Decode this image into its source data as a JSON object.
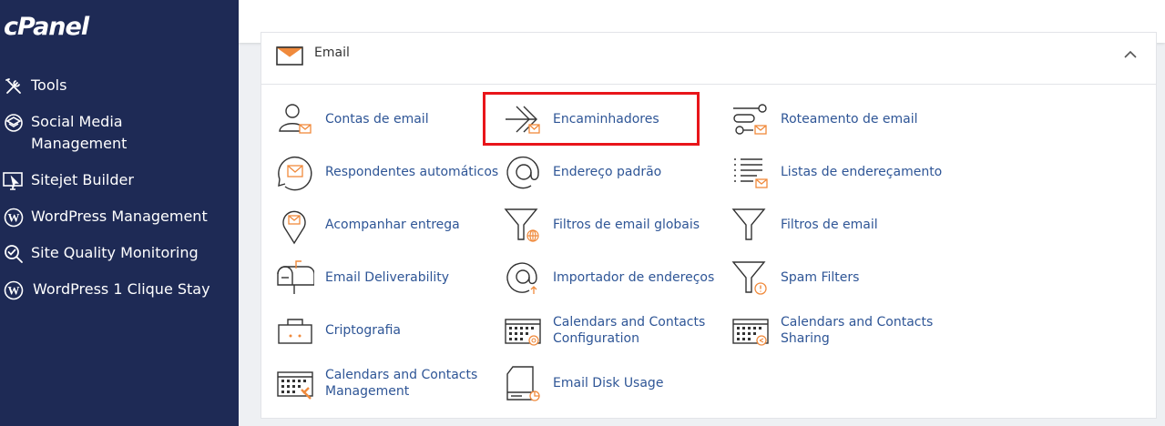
{
  "brand": {
    "logo": "cPanel"
  },
  "sidebar": {
    "items": [
      {
        "label": "Tools",
        "icon": "tools-icon"
      },
      {
        "label": "Social Media Management",
        "icon": "social-media-icon"
      },
      {
        "label": "Sitejet Builder",
        "icon": "sitejet-icon"
      },
      {
        "label": "WordPress Management",
        "icon": "wordpress-icon"
      },
      {
        "label": "Site Quality Monitoring",
        "icon": "site-quality-icon"
      },
      {
        "label": "WordPress 1 Clique Stay",
        "icon": "wordpress-icon"
      }
    ]
  },
  "section": {
    "title": "Email",
    "icon": "envelope-icon",
    "expanded": true
  },
  "tools": [
    {
      "label": "Contas de email",
      "icon": "email-accounts-icon"
    },
    {
      "label": "Encaminhadores",
      "icon": "forwarders-icon"
    },
    {
      "label": "Roteamento de email",
      "icon": "email-routing-icon"
    },
    {
      "label": "Respondentes automáticos",
      "icon": "autoresponders-icon"
    },
    {
      "label": "Endereço padrão",
      "icon": "default-address-icon"
    },
    {
      "label": "Listas de endereçamento",
      "icon": "mailing-lists-icon"
    },
    {
      "label": "Acompanhar entrega",
      "icon": "track-delivery-icon"
    },
    {
      "label": "Filtros de email globais",
      "icon": "global-filters-icon"
    },
    {
      "label": "Filtros de email",
      "icon": "email-filters-icon"
    },
    {
      "label": "Email Deliverability",
      "icon": "mailbox-icon"
    },
    {
      "label": "Importador de endereços",
      "icon": "address-importer-icon"
    },
    {
      "label": "Spam Filters",
      "icon": "spam-filters-icon"
    },
    {
      "label": "Criptografia",
      "icon": "encryption-icon"
    },
    {
      "label": "Calendars and Contacts Configuration",
      "icon": "calendar-config-icon"
    },
    {
      "label": "Calendars and Contacts Sharing",
      "icon": "calendar-sharing-icon"
    },
    {
      "label": "Calendars and Contacts Management",
      "icon": "calendar-management-icon"
    },
    {
      "label": "Email Disk Usage",
      "icon": "disk-usage-icon"
    }
  ],
  "colors": {
    "sidebar": "#1e2a55",
    "link": "#2e5596",
    "accent": "#f08a3c",
    "highlight": "#e8151a"
  }
}
